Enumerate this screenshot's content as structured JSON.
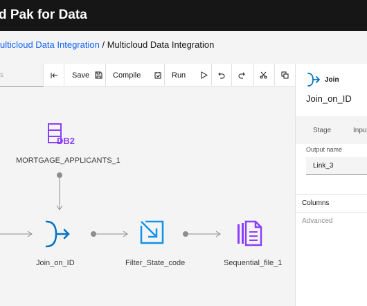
{
  "header": {
    "title": "d Pak for Data"
  },
  "breadcrumb": {
    "parent": "ulticloud Data Integration",
    "separator": "/",
    "current": "Multicloud Data Integration"
  },
  "toolbar": {
    "search_placeholder": "s",
    "save_label": "Save",
    "compile_label": "Compile",
    "run_label": "Run"
  },
  "canvas": {
    "nodes": {
      "source": "MORTGAGE_APPLICANTS_1",
      "source_icon_text": "DB2",
      "join": "Join_on_ID",
      "filter": "Filter_State_code",
      "sequential": "Sequential_file_1"
    }
  },
  "panel": {
    "stage_type": "Join",
    "stage_name": "Join_on_ID",
    "tabs": [
      "Stage",
      "Input"
    ],
    "output_name_label": "Output name",
    "output_name_value": "Link_3",
    "columns_label": "Columns",
    "advanced_label": "Advanced"
  },
  "colors": {
    "accent": "#0f62fe",
    "db2_purple": "#8a3ffc",
    "join_blue": "#0072c3",
    "filter_blue": "#1192e8"
  }
}
